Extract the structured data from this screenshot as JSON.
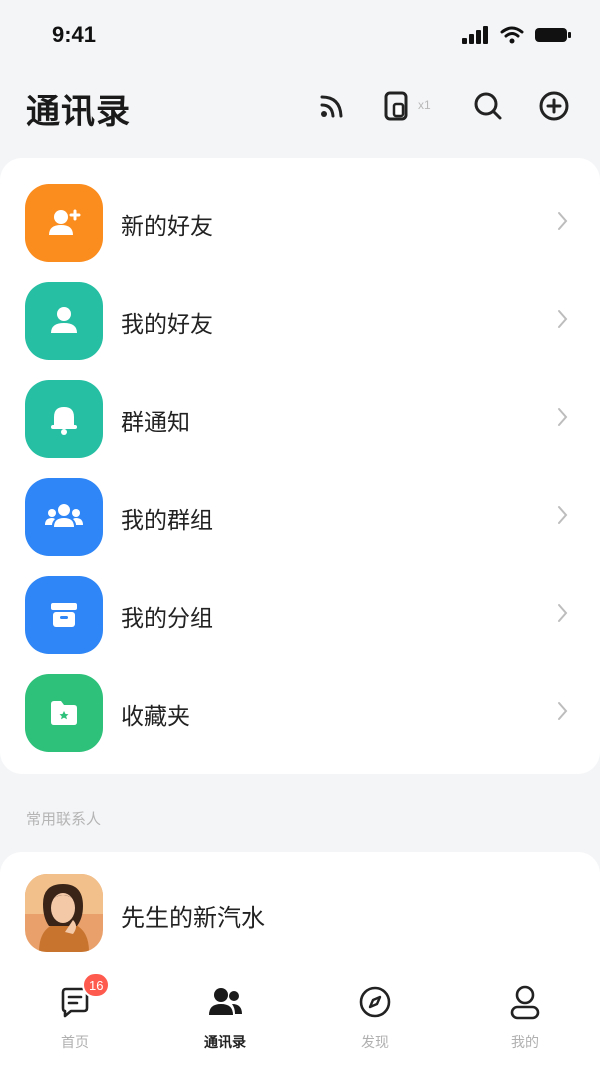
{
  "status": {
    "time": "9:41"
  },
  "header": {
    "title": "通讯录",
    "device_count": "x1"
  },
  "menu": {
    "items": [
      {
        "label": "新的好友",
        "color": "#fb8c1e",
        "icon": "add-user-icon"
      },
      {
        "label": "我的好友",
        "color": "#26bfa3",
        "icon": "user-icon"
      },
      {
        "label": "群通知",
        "color": "#26bfa3",
        "icon": "bell-icon"
      },
      {
        "label": "我的群组",
        "color": "#2f86f6",
        "icon": "group-icon"
      },
      {
        "label": "我的分组",
        "color": "#2f86f6",
        "icon": "box-icon"
      },
      {
        "label": "收藏夹",
        "color": "#2ec17a",
        "icon": "folder-icon"
      }
    ]
  },
  "frequent": {
    "section_title": "常用联系人",
    "contacts": [
      {
        "name": "先生的新汽水"
      }
    ]
  },
  "tabbar": {
    "tabs": [
      {
        "label": "首页",
        "badge": "16",
        "icon": "chat-icon"
      },
      {
        "label": "通讯录",
        "icon": "contacts-icon",
        "active": true
      },
      {
        "label": "发现",
        "icon": "compass-icon"
      },
      {
        "label": "我的",
        "icon": "profile-icon"
      }
    ]
  }
}
